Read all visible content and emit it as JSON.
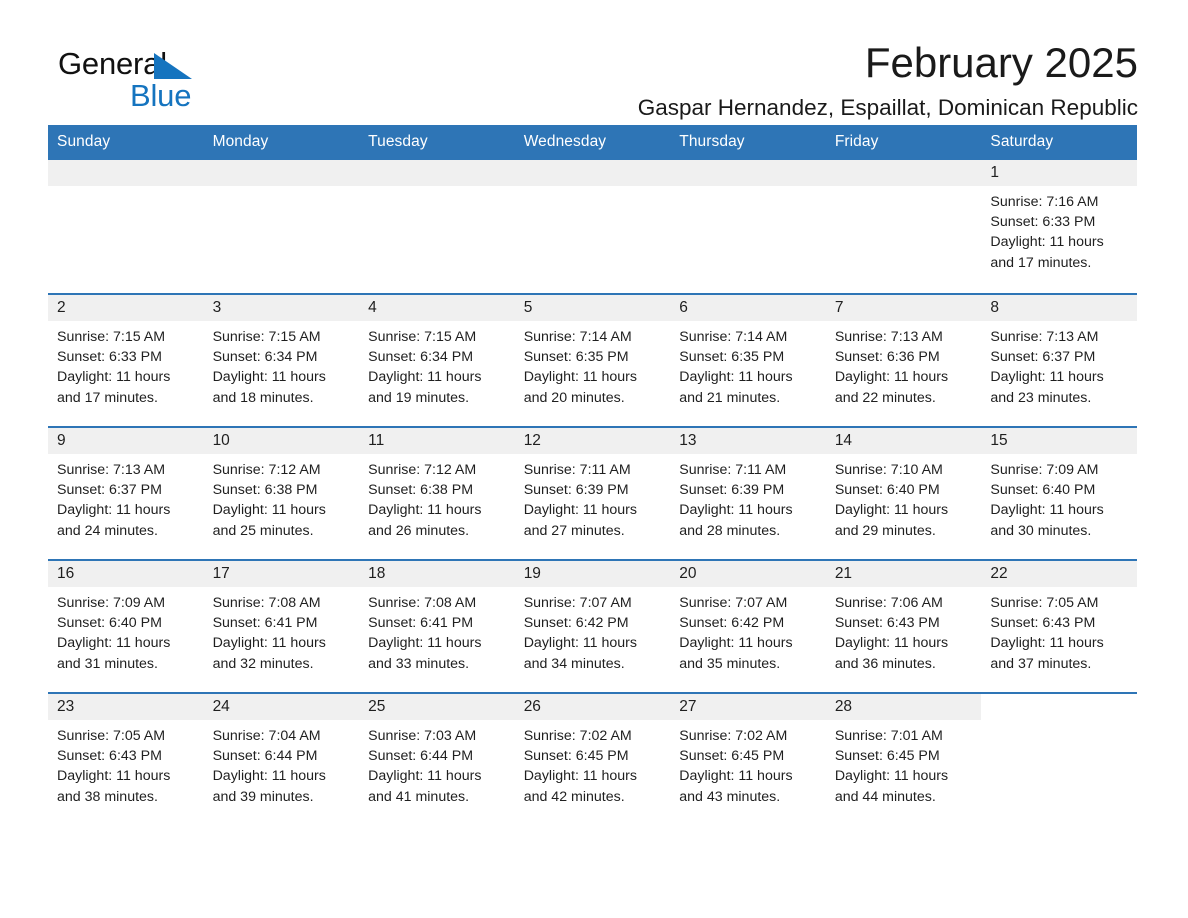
{
  "brand": {
    "name_part1": "General",
    "name_part2": "Blue",
    "triangle_color": "#1574bf"
  },
  "header": {
    "month_title": "February 2025",
    "location": "Gaspar Hernandez, Espaillat, Dominican Republic"
  },
  "theme": {
    "header_blue": "#2e75b6",
    "daynum_strip": "#f0f0f0",
    "text": "#1f1f1f",
    "page_background": "#ffffff"
  },
  "calendar": {
    "weekday_headers": [
      "Sunday",
      "Monday",
      "Tuesday",
      "Wednesday",
      "Thursday",
      "Friday",
      "Saturday"
    ],
    "weeks": [
      [
        {
          "day": "",
          "empty": true
        },
        {
          "day": "",
          "empty": true
        },
        {
          "day": "",
          "empty": true
        },
        {
          "day": "",
          "empty": true
        },
        {
          "day": "",
          "empty": true
        },
        {
          "day": "",
          "empty": true
        },
        {
          "day": "1",
          "sunrise": "Sunrise: 7:16 AM",
          "sunset": "Sunset: 6:33 PM",
          "daylight": "Daylight: 11 hours and 17 minutes."
        }
      ],
      [
        {
          "day": "2",
          "sunrise": "Sunrise: 7:15 AM",
          "sunset": "Sunset: 6:33 PM",
          "daylight": "Daylight: 11 hours and 17 minutes."
        },
        {
          "day": "3",
          "sunrise": "Sunrise: 7:15 AM",
          "sunset": "Sunset: 6:34 PM",
          "daylight": "Daylight: 11 hours and 18 minutes."
        },
        {
          "day": "4",
          "sunrise": "Sunrise: 7:15 AM",
          "sunset": "Sunset: 6:34 PM",
          "daylight": "Daylight: 11 hours and 19 minutes."
        },
        {
          "day": "5",
          "sunrise": "Sunrise: 7:14 AM",
          "sunset": "Sunset: 6:35 PM",
          "daylight": "Daylight: 11 hours and 20 minutes."
        },
        {
          "day": "6",
          "sunrise": "Sunrise: 7:14 AM",
          "sunset": "Sunset: 6:35 PM",
          "daylight": "Daylight: 11 hours and 21 minutes."
        },
        {
          "day": "7",
          "sunrise": "Sunrise: 7:13 AM",
          "sunset": "Sunset: 6:36 PM",
          "daylight": "Daylight: 11 hours and 22 minutes."
        },
        {
          "day": "8",
          "sunrise": "Sunrise: 7:13 AM",
          "sunset": "Sunset: 6:37 PM",
          "daylight": "Daylight: 11 hours and 23 minutes."
        }
      ],
      [
        {
          "day": "9",
          "sunrise": "Sunrise: 7:13 AM",
          "sunset": "Sunset: 6:37 PM",
          "daylight": "Daylight: 11 hours and 24 minutes."
        },
        {
          "day": "10",
          "sunrise": "Sunrise: 7:12 AM",
          "sunset": "Sunset: 6:38 PM",
          "daylight": "Daylight: 11 hours and 25 minutes."
        },
        {
          "day": "11",
          "sunrise": "Sunrise: 7:12 AM",
          "sunset": "Sunset: 6:38 PM",
          "daylight": "Daylight: 11 hours and 26 minutes."
        },
        {
          "day": "12",
          "sunrise": "Sunrise: 7:11 AM",
          "sunset": "Sunset: 6:39 PM",
          "daylight": "Daylight: 11 hours and 27 minutes."
        },
        {
          "day": "13",
          "sunrise": "Sunrise: 7:11 AM",
          "sunset": "Sunset: 6:39 PM",
          "daylight": "Daylight: 11 hours and 28 minutes."
        },
        {
          "day": "14",
          "sunrise": "Sunrise: 7:10 AM",
          "sunset": "Sunset: 6:40 PM",
          "daylight": "Daylight: 11 hours and 29 minutes."
        },
        {
          "day": "15",
          "sunrise": "Sunrise: 7:09 AM",
          "sunset": "Sunset: 6:40 PM",
          "daylight": "Daylight: 11 hours and 30 minutes."
        }
      ],
      [
        {
          "day": "16",
          "sunrise": "Sunrise: 7:09 AM",
          "sunset": "Sunset: 6:40 PM",
          "daylight": "Daylight: 11 hours and 31 minutes."
        },
        {
          "day": "17",
          "sunrise": "Sunrise: 7:08 AM",
          "sunset": "Sunset: 6:41 PM",
          "daylight": "Daylight: 11 hours and 32 minutes."
        },
        {
          "day": "18",
          "sunrise": "Sunrise: 7:08 AM",
          "sunset": "Sunset: 6:41 PM",
          "daylight": "Daylight: 11 hours and 33 minutes."
        },
        {
          "day": "19",
          "sunrise": "Sunrise: 7:07 AM",
          "sunset": "Sunset: 6:42 PM",
          "daylight": "Daylight: 11 hours and 34 minutes."
        },
        {
          "day": "20",
          "sunrise": "Sunrise: 7:07 AM",
          "sunset": "Sunset: 6:42 PM",
          "daylight": "Daylight: 11 hours and 35 minutes."
        },
        {
          "day": "21",
          "sunrise": "Sunrise: 7:06 AM",
          "sunset": "Sunset: 6:43 PM",
          "daylight": "Daylight: 11 hours and 36 minutes."
        },
        {
          "day": "22",
          "sunrise": "Sunrise: 7:05 AM",
          "sunset": "Sunset: 6:43 PM",
          "daylight": "Daylight: 11 hours and 37 minutes."
        }
      ],
      [
        {
          "day": "23",
          "sunrise": "Sunrise: 7:05 AM",
          "sunset": "Sunset: 6:43 PM",
          "daylight": "Daylight: 11 hours and 38 minutes."
        },
        {
          "day": "24",
          "sunrise": "Sunrise: 7:04 AM",
          "sunset": "Sunset: 6:44 PM",
          "daylight": "Daylight: 11 hours and 39 minutes."
        },
        {
          "day": "25",
          "sunrise": "Sunrise: 7:03 AM",
          "sunset": "Sunset: 6:44 PM",
          "daylight": "Daylight: 11 hours and 41 minutes."
        },
        {
          "day": "26",
          "sunrise": "Sunrise: 7:02 AM",
          "sunset": "Sunset: 6:45 PM",
          "daylight": "Daylight: 11 hours and 42 minutes."
        },
        {
          "day": "27",
          "sunrise": "Sunrise: 7:02 AM",
          "sunset": "Sunset: 6:45 PM",
          "daylight": "Daylight: 11 hours and 43 minutes."
        },
        {
          "day": "28",
          "sunrise": "Sunrise: 7:01 AM",
          "sunset": "Sunset: 6:45 PM",
          "daylight": "Daylight: 11 hours and 44 minutes."
        },
        {
          "day": "",
          "empty": true,
          "noStrip": true
        }
      ]
    ]
  }
}
